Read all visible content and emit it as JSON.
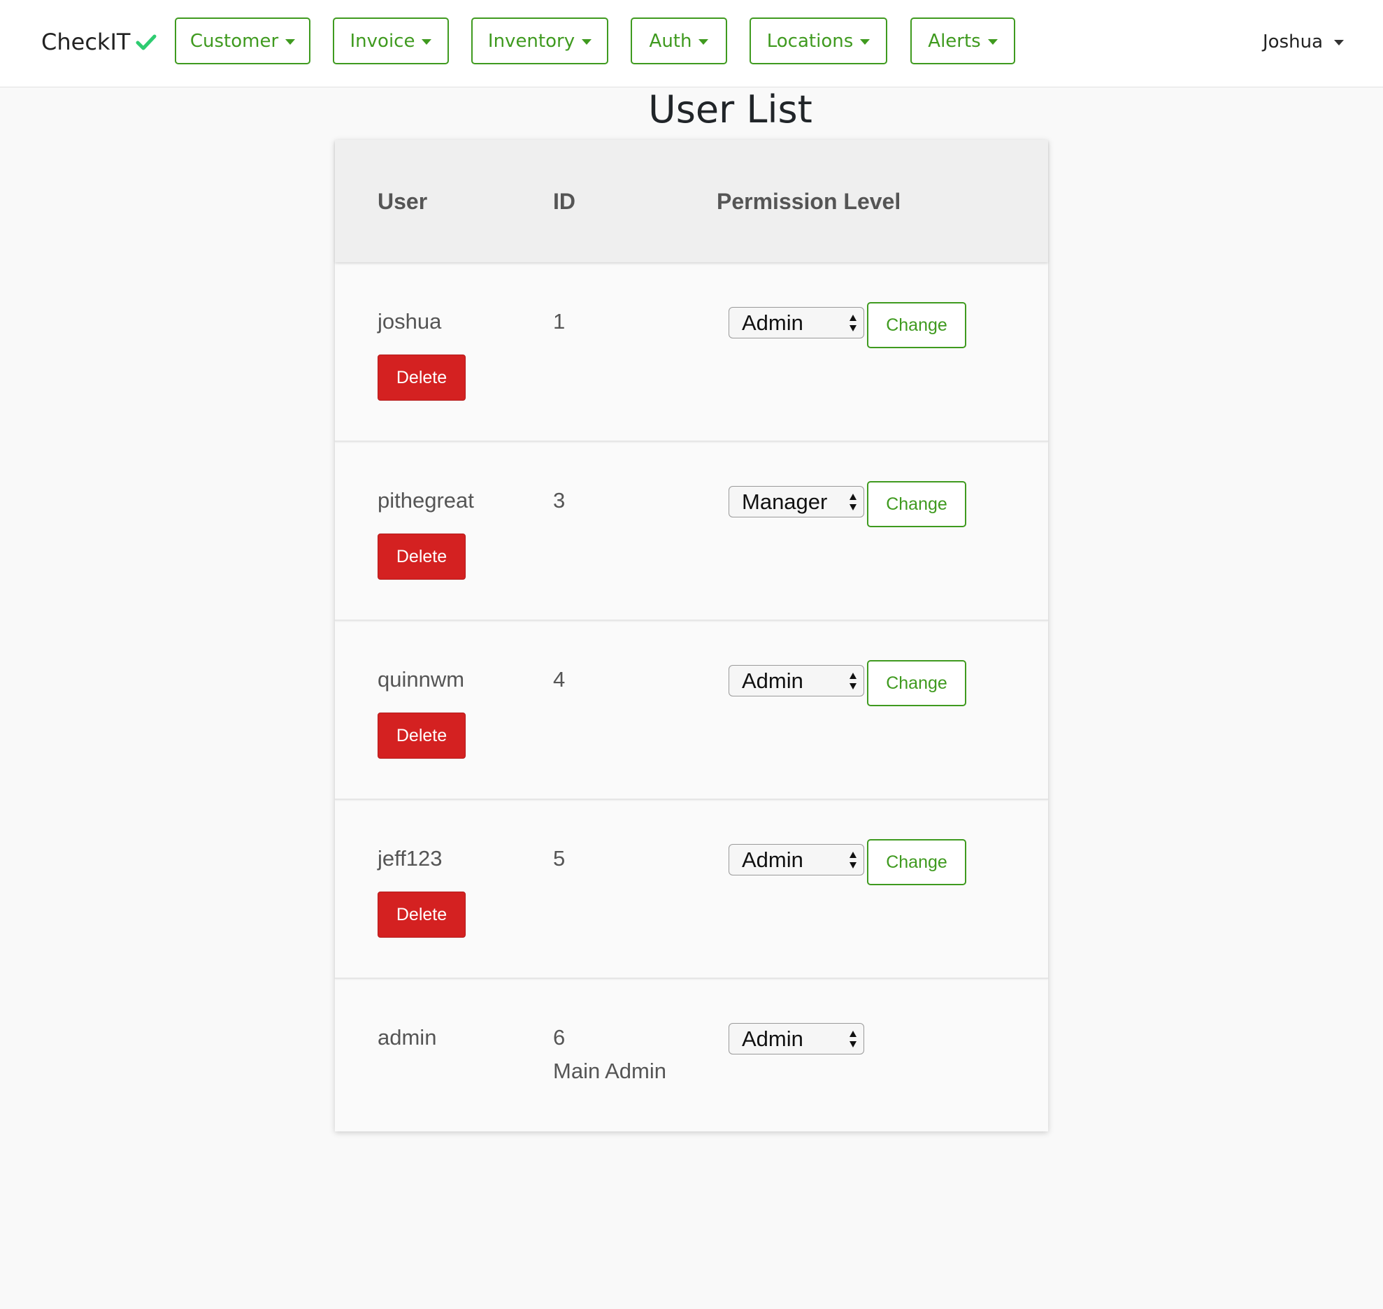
{
  "app": {
    "brand": "CheckIT",
    "colors": {
      "accent": "#3f9a1f",
      "check": "#2ecc71",
      "danger": "#d42121"
    }
  },
  "nav": {
    "items": [
      {
        "label": "Customer"
      },
      {
        "label": "Invoice"
      },
      {
        "label": "Inventory"
      },
      {
        "label": "Auth"
      },
      {
        "label": "Locations"
      },
      {
        "label": "Alerts"
      }
    ],
    "user": "Joshua"
  },
  "page": {
    "title": "User List"
  },
  "table": {
    "headers": {
      "user": "User",
      "id": "ID",
      "permission": "Permission Level"
    },
    "rows": [
      {
        "user": "joshua",
        "id": "1",
        "permission": "Admin",
        "delete_label": "Delete",
        "change_label": "Change"
      },
      {
        "user": "pithegreat",
        "id": "3",
        "permission": "Manager",
        "delete_label": "Delete",
        "change_label": "Change"
      },
      {
        "user": "quinnwm",
        "id": "4",
        "permission": "Admin",
        "delete_label": "Delete",
        "change_label": "Change"
      },
      {
        "user": "jeff123",
        "id": "5",
        "permission": "Admin",
        "delete_label": "Delete",
        "change_label": "Change"
      },
      {
        "user": "admin",
        "id": "6",
        "note": "Main Admin",
        "permission": "Admin"
      }
    ]
  }
}
